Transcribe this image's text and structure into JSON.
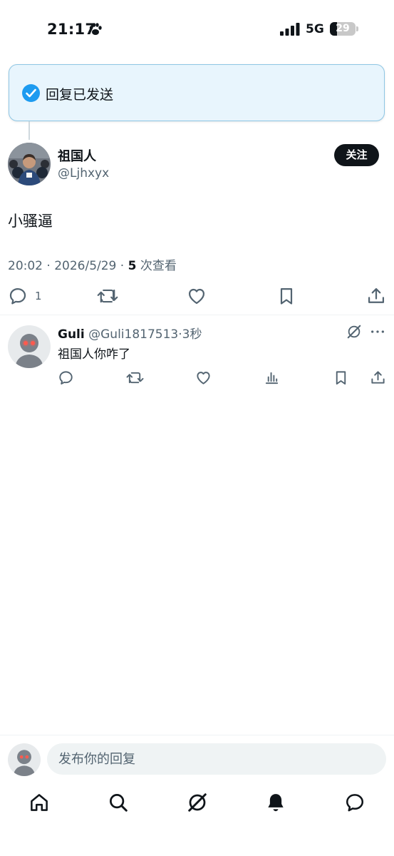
{
  "status_bar": {
    "time": "21:17",
    "network": "5G",
    "battery_level": 29,
    "battery_text": "29"
  },
  "toast": {
    "text": "回复已发送",
    "icon": "check-circle-icon",
    "accent": "#1d9bf0"
  },
  "tweet": {
    "author_name": "祖国人",
    "author_handle": "@Ljhxyx",
    "follow_label": "关注",
    "text": "小骚逼",
    "time": "20:02 · 2026/5/29 · ",
    "views_count": "5",
    "views_label": " 次查看",
    "reply_count": "1"
  },
  "reply": {
    "name": "Guli",
    "handle": " @Guli1817513",
    "time": "·3秒",
    "text": "祖国人你咋了"
  },
  "composer": {
    "placeholder": "发布你的回复"
  },
  "nav": [
    "home-icon",
    "search-icon",
    "grok-icon",
    "notifications-icon",
    "messages-icon"
  ],
  "colors": {
    "text_primary": "#0f1419",
    "text_secondary": "#536471",
    "divider": "#eff3f4",
    "toast_bg": "#e8f5fd"
  }
}
